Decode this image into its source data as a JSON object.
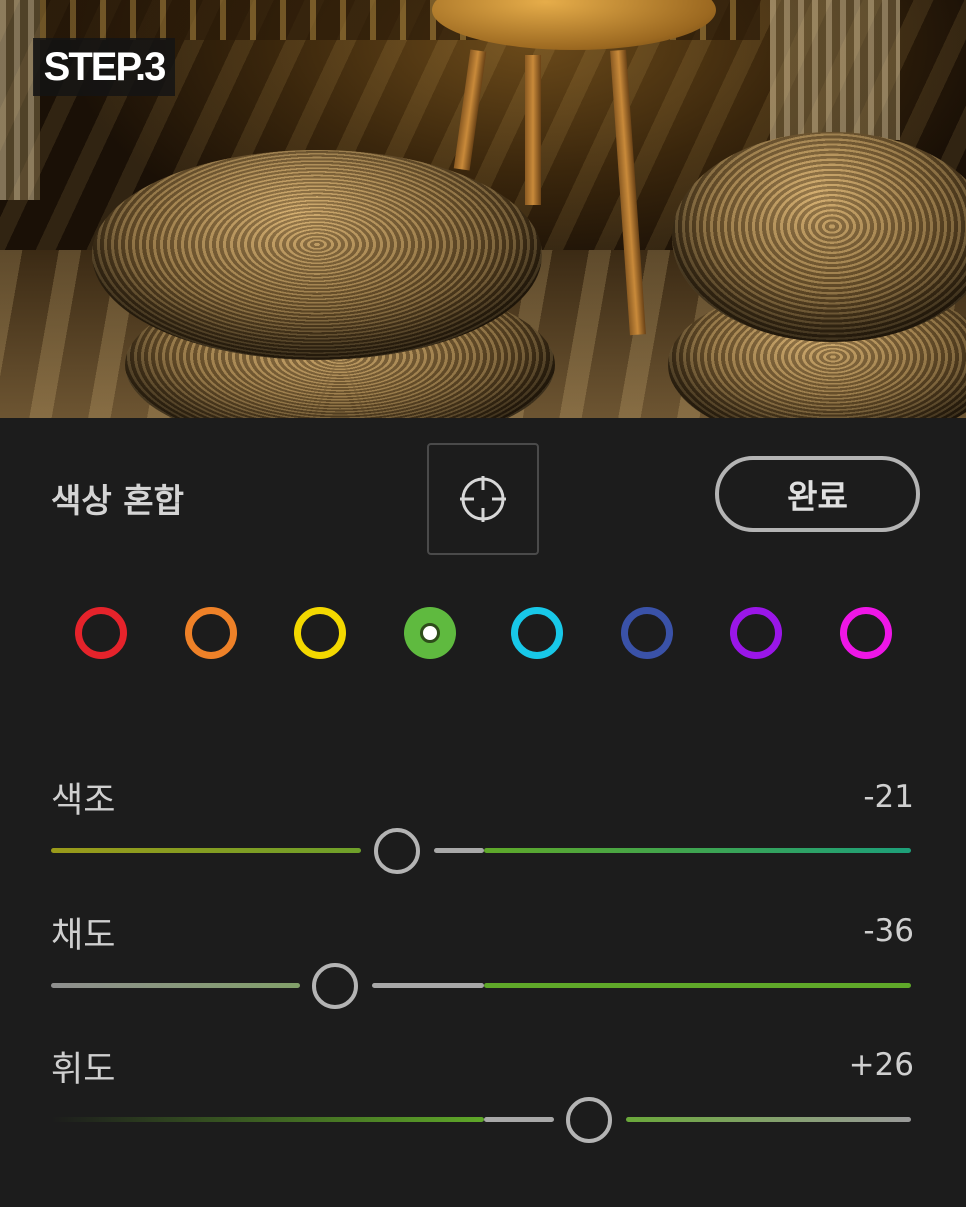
{
  "badge": {
    "text": "STEP.3"
  },
  "panel": {
    "title": "색상 혼합",
    "done_label": "완료",
    "target_tool": "target-adjust-icon"
  },
  "swatches": [
    {
      "name": "red",
      "color": "#e5232b",
      "selected": false
    },
    {
      "name": "orange",
      "color": "#ee8128",
      "selected": false
    },
    {
      "name": "yellow",
      "color": "#f3d800",
      "selected": false
    },
    {
      "name": "green",
      "color": "#5fba3f",
      "selected": true
    },
    {
      "name": "aqua",
      "color": "#18c8e8",
      "selected": false
    },
    {
      "name": "blue",
      "color": "#3a52a8",
      "selected": false
    },
    {
      "name": "purple",
      "color": "#9a16e8",
      "selected": false
    },
    {
      "name": "magenta",
      "color": "#ee16e6",
      "selected": false
    }
  ],
  "sliders": [
    {
      "key": "hue",
      "label": "색조",
      "value": "-21"
    },
    {
      "key": "saturation",
      "label": "채도",
      "value": "-36"
    },
    {
      "key": "luminance",
      "label": "휘도",
      "value": "+26"
    }
  ],
  "colors": {
    "background": "#1c1c1c",
    "thumb": "#b4b4b4",
    "green": "#5fa829"
  }
}
